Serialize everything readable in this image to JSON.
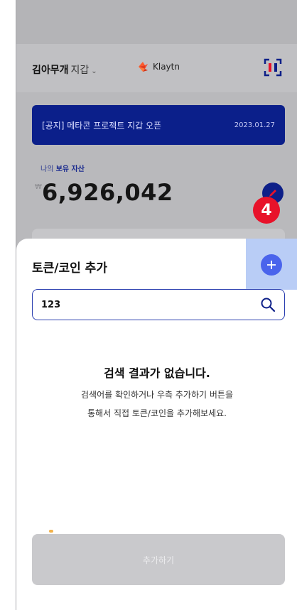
{
  "header": {
    "wallet_name": "김아무개",
    "wallet_suffix": "지갑",
    "wallet_chevron": "⌄",
    "network_name": "Klaytn",
    "scan_icon": "qr-scan-icon"
  },
  "notice": {
    "text": "[공지]  메타콘 프로젝트 지갑 오픈",
    "date": "2023.01.27"
  },
  "assets": {
    "label_prefix": "나의 ",
    "label_bold": "보유 자산",
    "currency_symbol": "₩",
    "amount": "6,926,042"
  },
  "sheet": {
    "title": "토큰/코인 추가",
    "search_value": "123",
    "empty_title": "검색 결과가 없습니다.",
    "empty_desc_line1": "검색어를 확인하거나 우측 추가하기 버튼을",
    "empty_desc_line2": "통해서 직접 토큰/코인을 추가해보세요.",
    "submit_label": "추가하기"
  },
  "annotation": {
    "step_number": "4"
  },
  "colors": {
    "primary": "#0b1f8a",
    "add_button": "#4a64ec",
    "badge": "#e8122a",
    "highlight": "#b9cdf6"
  }
}
